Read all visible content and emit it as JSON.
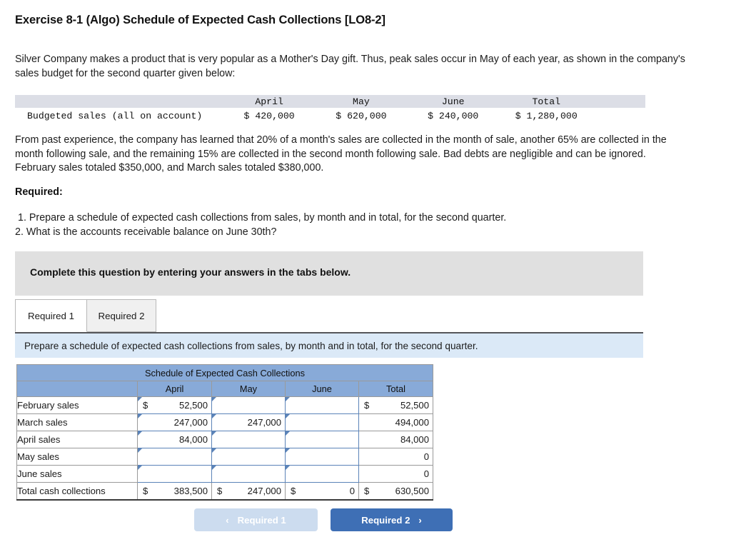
{
  "page_title": "Exercise 8-1 (Algo) Schedule of Expected Cash Collections [LO8-2]",
  "intro_paragraph": "Silver Company makes a product that is very popular as a Mother's Day gift. Thus, peak sales occur in May of each year, as shown in the company's sales budget for the second quarter given below:",
  "budget_table": {
    "headers": [
      "",
      "April",
      "May",
      "June",
      "Total"
    ],
    "rows": [
      {
        "label": "Budgeted sales (all on account)",
        "april": "$ 420,000",
        "may": "$ 620,000",
        "june": "$ 240,000",
        "total": "$ 1,280,000"
      }
    ]
  },
  "body_paragraph": "From past experience, the company has learned that 20% of a month's sales are collected in the month of sale, another 65% are collected in the month following sale, and the remaining 15% are collected in the second month following sale. Bad debts are negligible and can be ignored. February sales totaled $350,000, and March sales totaled $380,000.",
  "required_heading": "Required:",
  "required_items": [
    "1. Prepare a schedule of expected cash collections from sales, by month and in total, for the second quarter.",
    "2. What is the accounts receivable balance on June 30th?"
  ],
  "instruction_bar": "Complete this question by entering your answers in the tabs below.",
  "tabs": [
    {
      "label": "Required 1",
      "active": true
    },
    {
      "label": "Required 2",
      "active": false
    }
  ],
  "tab_banner": "Prepare a schedule of expected cash collections from sales, by month and in total, for the second quarter.",
  "answer_grid": {
    "title": "Schedule of Expected Cash Collections",
    "columns": [
      "",
      "April",
      "May",
      "June",
      "Total"
    ],
    "rows": [
      {
        "label": "February sales",
        "april_dollar": "$",
        "april": "52,500",
        "may_dollar": "",
        "may": "",
        "june_dollar": "",
        "june": "",
        "total_dollar": "$",
        "total": "52,500"
      },
      {
        "label": "March sales",
        "april_dollar": "",
        "april": "247,000",
        "may_dollar": "",
        "may": "247,000",
        "june_dollar": "",
        "june": "",
        "total_dollar": "",
        "total": "494,000"
      },
      {
        "label": "April sales",
        "april_dollar": "",
        "april": "84,000",
        "may_dollar": "",
        "may": "",
        "june_dollar": "",
        "june": "",
        "total_dollar": "",
        "total": "84,000"
      },
      {
        "label": "May sales",
        "april_dollar": "",
        "april": "",
        "may_dollar": "",
        "may": "",
        "june_dollar": "",
        "june": "",
        "total_dollar": "",
        "total": "0"
      },
      {
        "label": "June sales",
        "april_dollar": "",
        "april": "",
        "may_dollar": "",
        "may": "",
        "june_dollar": "",
        "june": "",
        "total_dollar": "",
        "total": "0"
      }
    ],
    "total_row": {
      "label": "Total cash collections",
      "april_dollar": "$",
      "april": "383,500",
      "may_dollar": "$",
      "may": "247,000",
      "june_dollar": "$",
      "june": "0",
      "total_dollar": "$",
      "total": "630,500"
    }
  },
  "nav": {
    "prev_label": "Required 1",
    "prev_chevron": "‹",
    "next_label": "Required 2",
    "next_chevron": "›"
  },
  "colors": {
    "grid_header_blue": "#88aad8",
    "banner_blue": "#dbe9f7",
    "instruction_gray": "#e0e0e0",
    "button_blue": "#3e6fb5",
    "button_disabled": "#ccdcef",
    "input_border_blue": "#5b83b8"
  }
}
